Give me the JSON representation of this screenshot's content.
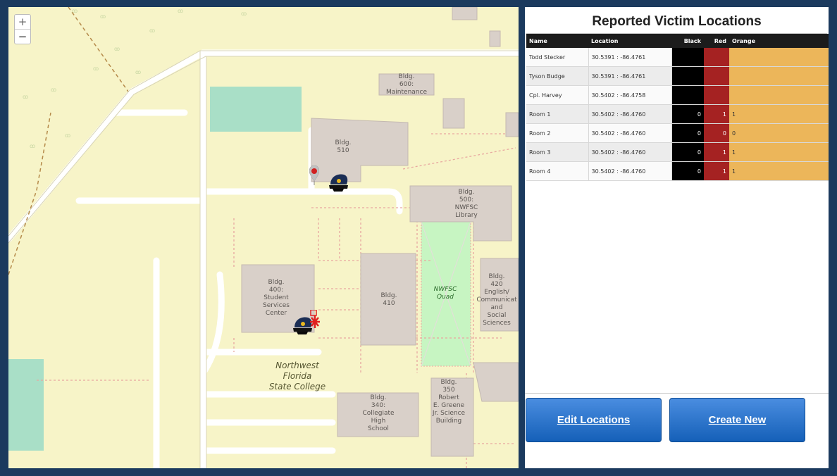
{
  "map": {
    "zoom_in": "+",
    "zoom_out": "−",
    "buildings": [
      {
        "id": "600",
        "label": "Bldg.\n600:\nMaintenance"
      },
      {
        "id": "510",
        "label": "Bldg.\n510"
      },
      {
        "id": "500",
        "label": "Bldg.\n500:\nNWFSC\nLibrary"
      },
      {
        "id": "400",
        "label": "Bldg.\n400:\nStudent\nServices\nCenter"
      },
      {
        "id": "410",
        "label": "Bldg.\n410"
      },
      {
        "id": "420",
        "label": "Bldg.\n420\nEnglish/\nCommunicat\nand\nSocial\nSciences"
      },
      {
        "id": "340",
        "label": "Bldg.\n340:\nCollegiate\nHigh\nSchool"
      },
      {
        "id": "350",
        "label": "Bldg.\n350\nRobert\nE. Greene\nJr. Science\nBuilding"
      }
    ],
    "quad_label": "NWFSC\nQuad",
    "campus_label": "Northwest\nFlorida\nState College",
    "markers": [
      "location-pin-icon",
      "police-cap-icon",
      "police-cap-icon",
      "medic-icon"
    ]
  },
  "panel": {
    "title": "Reported Victim Locations",
    "columns": [
      "Name",
      "Location",
      "Black",
      "Red",
      "Orange"
    ],
    "rows": [
      {
        "name": "Todd Stecker",
        "location": "30.5391 : -86.4761",
        "black": "",
        "red": "",
        "orange": ""
      },
      {
        "name": "Tyson Budge",
        "location": "30.5391 : -86.4761",
        "black": "",
        "red": "",
        "orange": ""
      },
      {
        "name": "Cpl. Harvey",
        "location": "30.5402 : -86.4758",
        "black": "",
        "red": "",
        "orange": ""
      },
      {
        "name": "Room 1",
        "location": "30.5402 : -86.4760",
        "black": "0",
        "red": "1",
        "orange": "1"
      },
      {
        "name": "Room 2",
        "location": "30.5402 : -86.4760",
        "black": "0",
        "red": "0",
        "orange": "0"
      },
      {
        "name": "Room 3",
        "location": "30.5402 : -86.4760",
        "black": "0",
        "red": "1",
        "orange": "1"
      },
      {
        "name": "Room 4",
        "location": "30.5402 : -86.4760",
        "black": "0",
        "red": "1",
        "orange": "1"
      }
    ],
    "colors": {
      "black": "#000000",
      "red": "#a52222",
      "orange": "#ecb65a"
    },
    "edit_button": "Edit Locations",
    "create_button": "Create New"
  }
}
